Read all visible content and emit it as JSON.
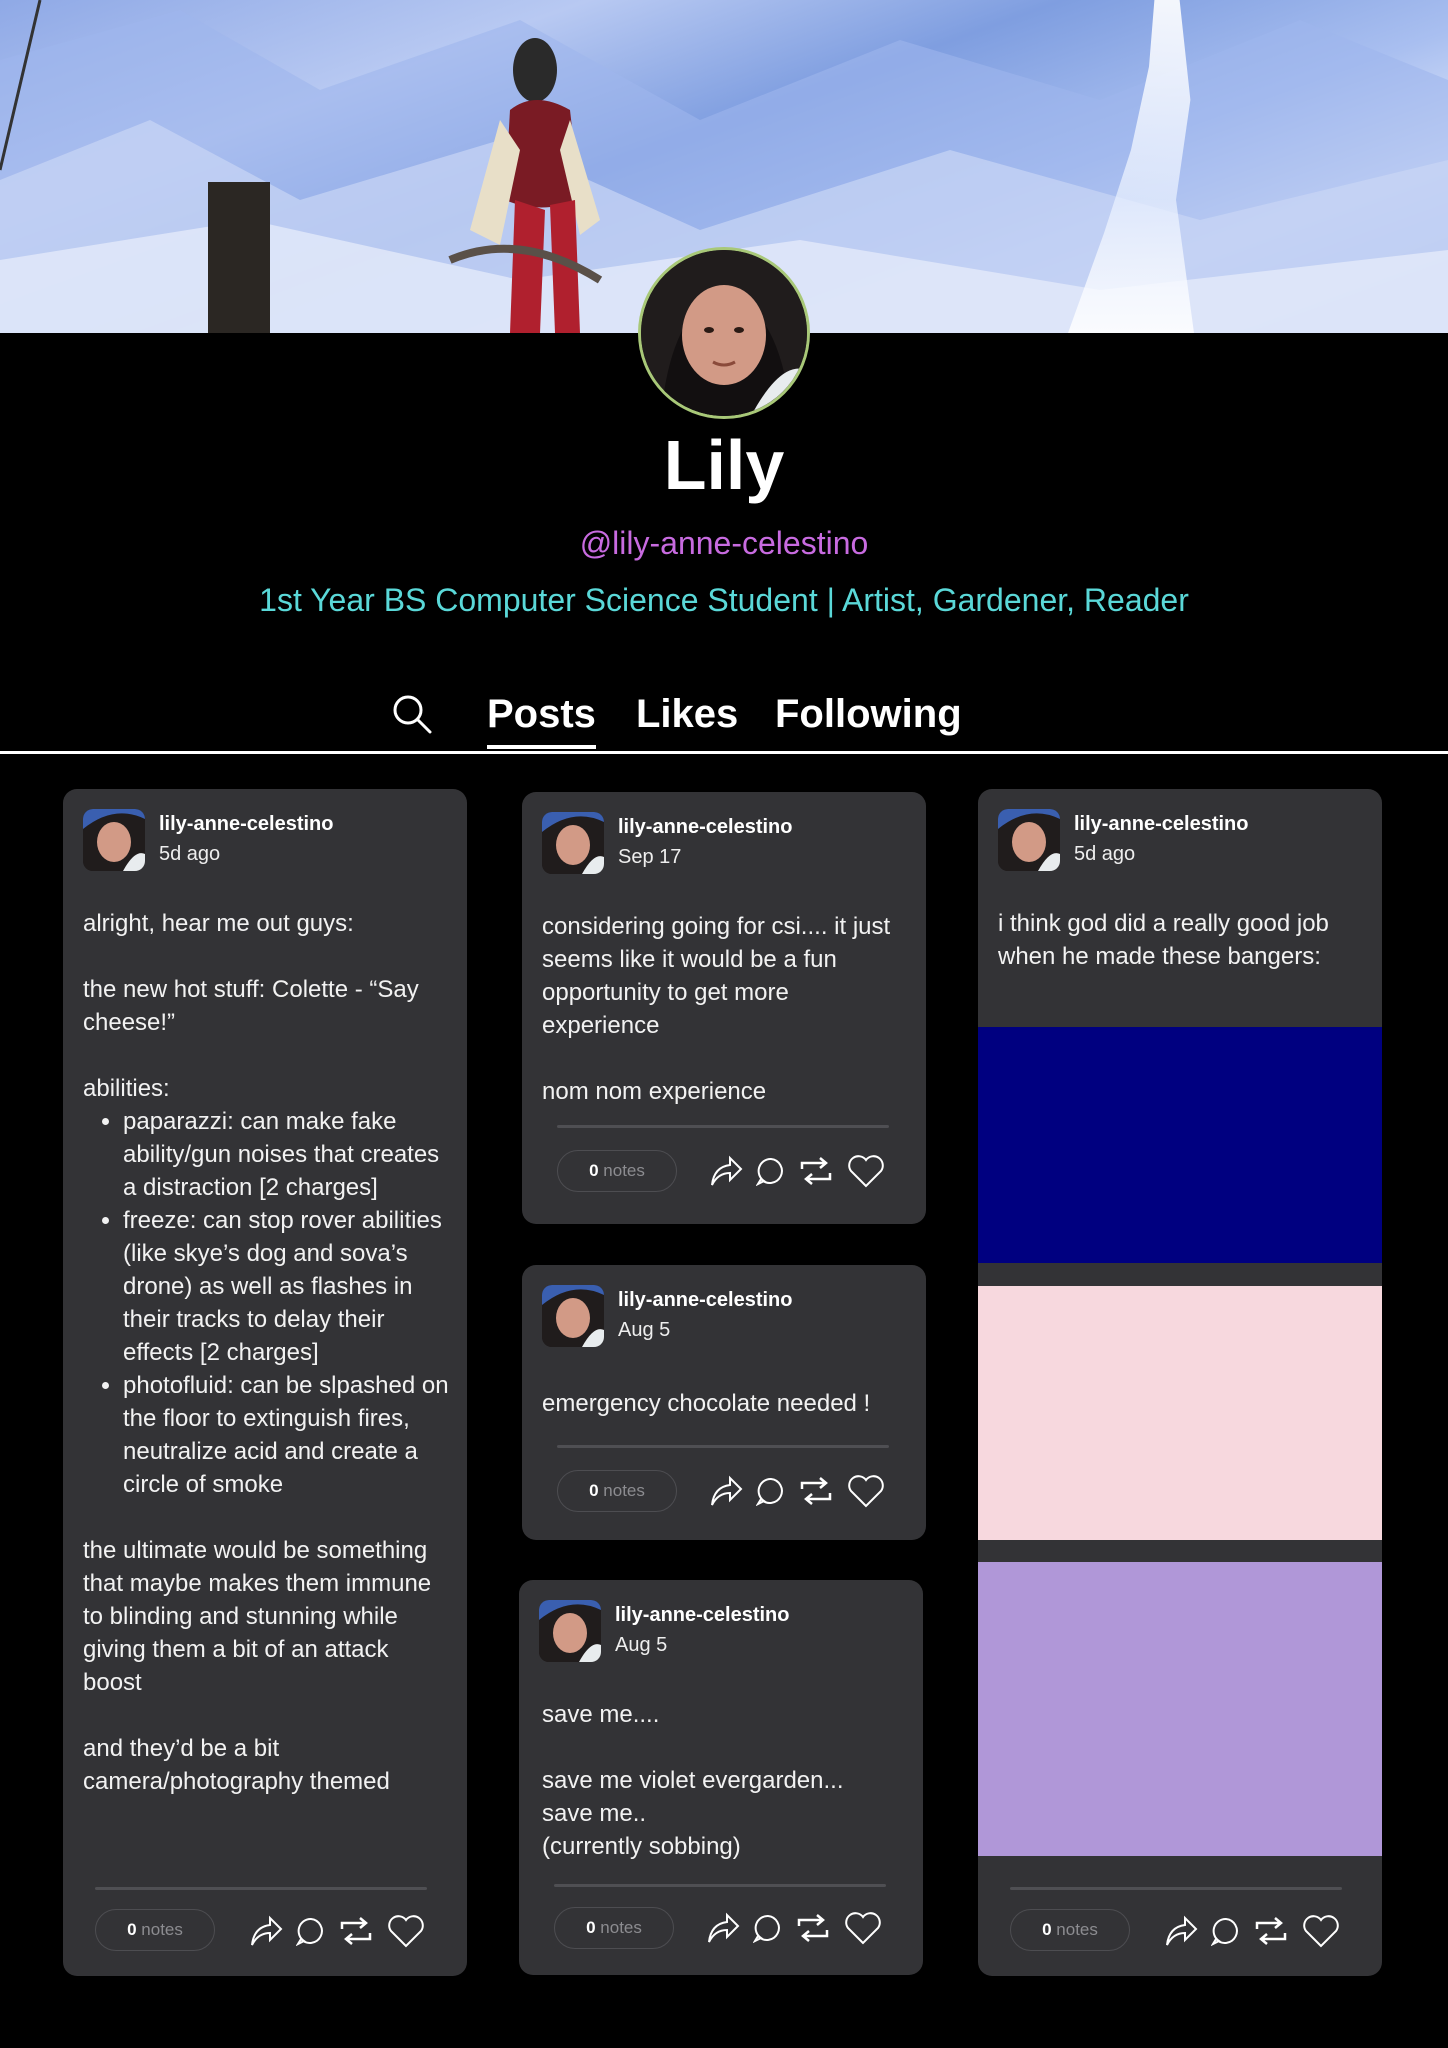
{
  "profile": {
    "name": "Lily",
    "handle": "@lily-anne-celestino",
    "bio": "1st Year BS Computer Science Student | Artist, Gardener, Reader"
  },
  "tabs": {
    "posts": "Posts",
    "likes": "Likes",
    "following": "Following"
  },
  "posts": [
    {
      "username": "lily-anne-celestino",
      "date": "5d ago",
      "p1": "alright, hear me out guys:",
      "p2": "the new hot stuff: Colette - “Say cheese!”",
      "p3": "abilities:",
      "bullets": [
        "paparazzi: can make fake ability/gun noises that creates a distraction [2 charges]",
        "freeze: can stop rover abilities (like skye’s dog and sova’s drone) as well as flashes in their tracks to delay their effects [2 charges]",
        "photofluid: can be slpashed on the floor to extinguish fires,  neutralize acid and create a circle of smoke"
      ],
      "p4": "the ultimate would be something that maybe makes them immune to blinding and stunning while giving them a bit of an attack boost",
      "p5": "and they’d be a bit camera/photography themed",
      "notes_count": "0",
      "notes_label": "notes"
    },
    {
      "username": "lily-anne-celestino",
      "date": "Sep 17",
      "p1": "considering going for csi.... it just seems like it would be a fun opportunity to get more experience",
      "p2": "nom nom experience",
      "notes_count": "0",
      "notes_label": "notes"
    },
    {
      "username": "lily-anne-celestino",
      "date": "Aug 5",
      "p1": "emergency chocolate needed !",
      "notes_count": "0",
      "notes_label": "notes"
    },
    {
      "username": "lily-anne-celestino",
      "date": "Aug 5",
      "p1": "save me....",
      "p2": "save me violet evergarden...",
      "p3": "save me..",
      "p4": "(currently sobbing)",
      "notes_count": "0",
      "notes_label": "notes"
    },
    {
      "username": "lily-anne-celestino",
      "date": "5d ago",
      "p1": "i think god did a really good job when he made these bangers:",
      "swatches": [
        "#000080",
        "#f7d8de",
        "#b097d8"
      ],
      "notes_count": "0",
      "notes_label": "notes"
    }
  ],
  "icons": [
    "search-icon",
    "share-icon",
    "reply-icon",
    "reblog-icon",
    "like-icon"
  ]
}
